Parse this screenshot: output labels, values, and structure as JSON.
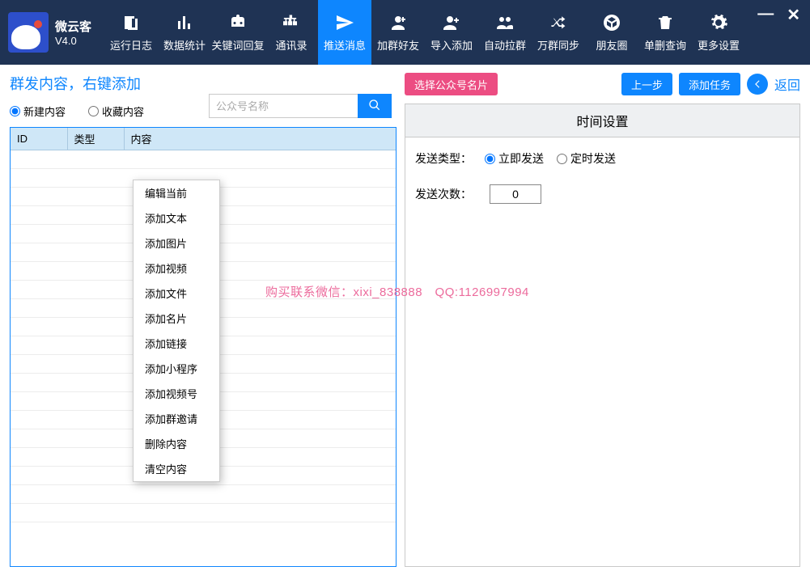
{
  "app": {
    "name": "微云客",
    "version": "V4.0"
  },
  "toolbar": [
    {
      "label": "运行日志",
      "icon": "log"
    },
    {
      "label": "数据统计",
      "icon": "chart"
    },
    {
      "label": "关键词回复",
      "icon": "robot"
    },
    {
      "label": "通讯录",
      "icon": "org"
    },
    {
      "label": "推送消息",
      "icon": "send",
      "active": true
    },
    {
      "label": "加群好友",
      "icon": "group-add"
    },
    {
      "label": "导入添加",
      "icon": "user-add"
    },
    {
      "label": "自动拉群",
      "icon": "users"
    },
    {
      "label": "万群同步",
      "icon": "shuffle"
    },
    {
      "label": "朋友圈",
      "icon": "lens"
    },
    {
      "label": "单删查询",
      "icon": "trash"
    },
    {
      "label": "更多设置",
      "icon": "gear"
    }
  ],
  "left": {
    "title": "群发内容，右键添加",
    "radios": {
      "new": "新建内容",
      "fav": "收藏内容"
    },
    "search_placeholder": "公众号名称",
    "table": {
      "headers": [
        "ID",
        "类型",
        "内容"
      ]
    }
  },
  "context_menu": [
    "编辑当前",
    "添加文本",
    "添加图片",
    "添加视频",
    "添加文件",
    "添加名片",
    "添加链接",
    "添加小程序",
    "添加视频号",
    "添加群邀请",
    "删除内容",
    "清空内容"
  ],
  "right": {
    "select_card": "选择公众号名片",
    "prev": "上一步",
    "add_task": "添加任务",
    "back": "返回",
    "settings_title": "时间设置",
    "send_type_label": "发送类型：",
    "send_now": "立即发送",
    "send_timed": "定时发送",
    "send_count_label": "发送次数：",
    "send_count_value": "0"
  },
  "watermark": "购买联系微信：xixi_838888　QQ:1126997994"
}
